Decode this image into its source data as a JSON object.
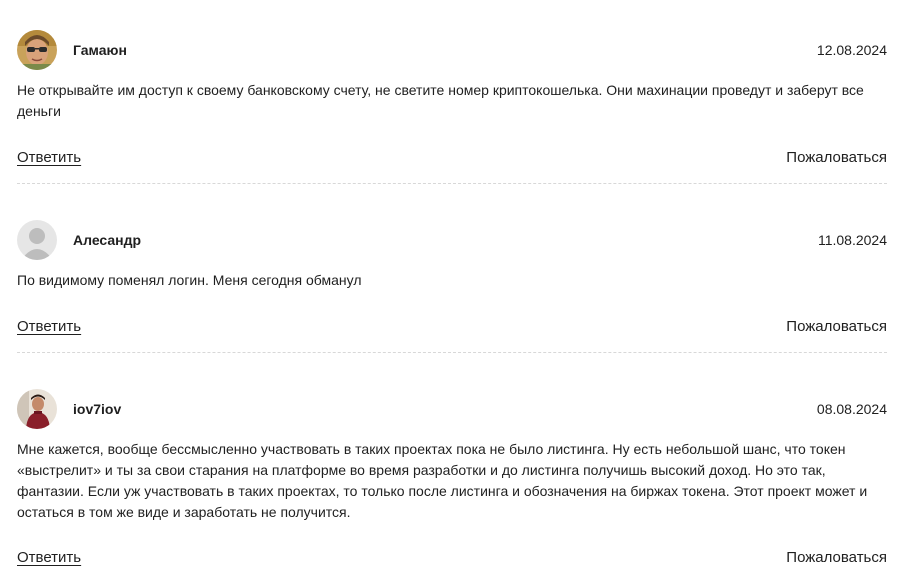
{
  "comments": [
    {
      "author": "Гамаюн",
      "date": "12.08.2024",
      "text": "Не открывайте им доступ к своему банковскому счету, не светите номер криптокошелька. Они махинации проведут и заберут все деньги",
      "reply_label": "Ответить",
      "report_label": "Пожаловаться"
    },
    {
      "author": "Алесандр",
      "date": "11.08.2024",
      "text": "По видимому поменял логин. Меня сегодня обманул",
      "reply_label": "Ответить",
      "report_label": "Пожаловаться"
    },
    {
      "author": "iov7iov",
      "date": "08.08.2024",
      "text": "Мне кажется, вообще бессмысленно участвовать в таких проектах пока не было листинга. Ну есть небольшой шанс, что токен «выстрелит» и ты за свои старания на платформе во время разработки и до листинга получишь высокий доход. Но это так, фантазии. Если уж участвовать в таких проектах, то только после листинга и обозначения на биржах токена. Этот проект может и остаться в том же виде и заработать не получится.",
      "reply_label": "Ответить",
      "report_label": "Пожаловаться"
    }
  ]
}
